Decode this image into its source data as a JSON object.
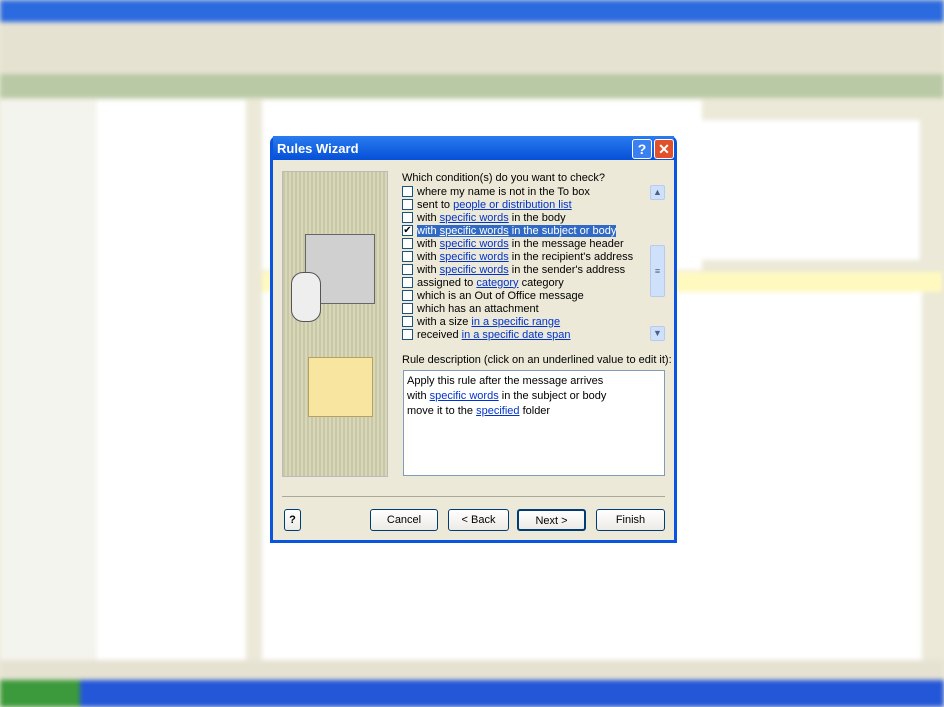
{
  "dialog": {
    "title": "Rules Wizard",
    "question": "Which condition(s) do you want to check?",
    "conditions": [
      {
        "checked": false,
        "before": "where my name is not in the To box",
        "link": "",
        "after": ""
      },
      {
        "checked": false,
        "before": "sent to ",
        "link": "people or distribution list",
        "after": ""
      },
      {
        "checked": false,
        "before": "with ",
        "link": "specific words",
        "after": " in the body"
      },
      {
        "checked": true,
        "before": "with ",
        "link": "specific words",
        "after": " in the subject or body"
      },
      {
        "checked": false,
        "before": "with ",
        "link": "specific words",
        "after": " in the message header"
      },
      {
        "checked": false,
        "before": "with ",
        "link": "specific words",
        "after": " in the recipient's address"
      },
      {
        "checked": false,
        "before": "with ",
        "link": "specific words",
        "after": " in the sender's address"
      },
      {
        "checked": false,
        "before": "assigned to ",
        "link": "category",
        "after": " category"
      },
      {
        "checked": false,
        "before": "which is an Out of Office message",
        "link": "",
        "after": ""
      },
      {
        "checked": false,
        "before": "which has an attachment",
        "link": "",
        "after": ""
      },
      {
        "checked": false,
        "before": "with a size ",
        "link": "in a specific range",
        "after": ""
      },
      {
        "checked": false,
        "before": "received ",
        "link": "in a specific date span",
        "after": ""
      }
    ],
    "description_label": "Rule description (click on an underlined value to edit it):",
    "description": {
      "line1": "Apply this rule after the message arrives",
      "line2_before": "with ",
      "line2_link": "specific words",
      "line2_after": " in the subject or body",
      "line3_before": "move it to the ",
      "line3_link": "specified",
      "line3_after": " folder"
    },
    "buttons": {
      "cancel": "Cancel",
      "back": "< Back",
      "next": "Next >",
      "finish": "Finish"
    }
  }
}
